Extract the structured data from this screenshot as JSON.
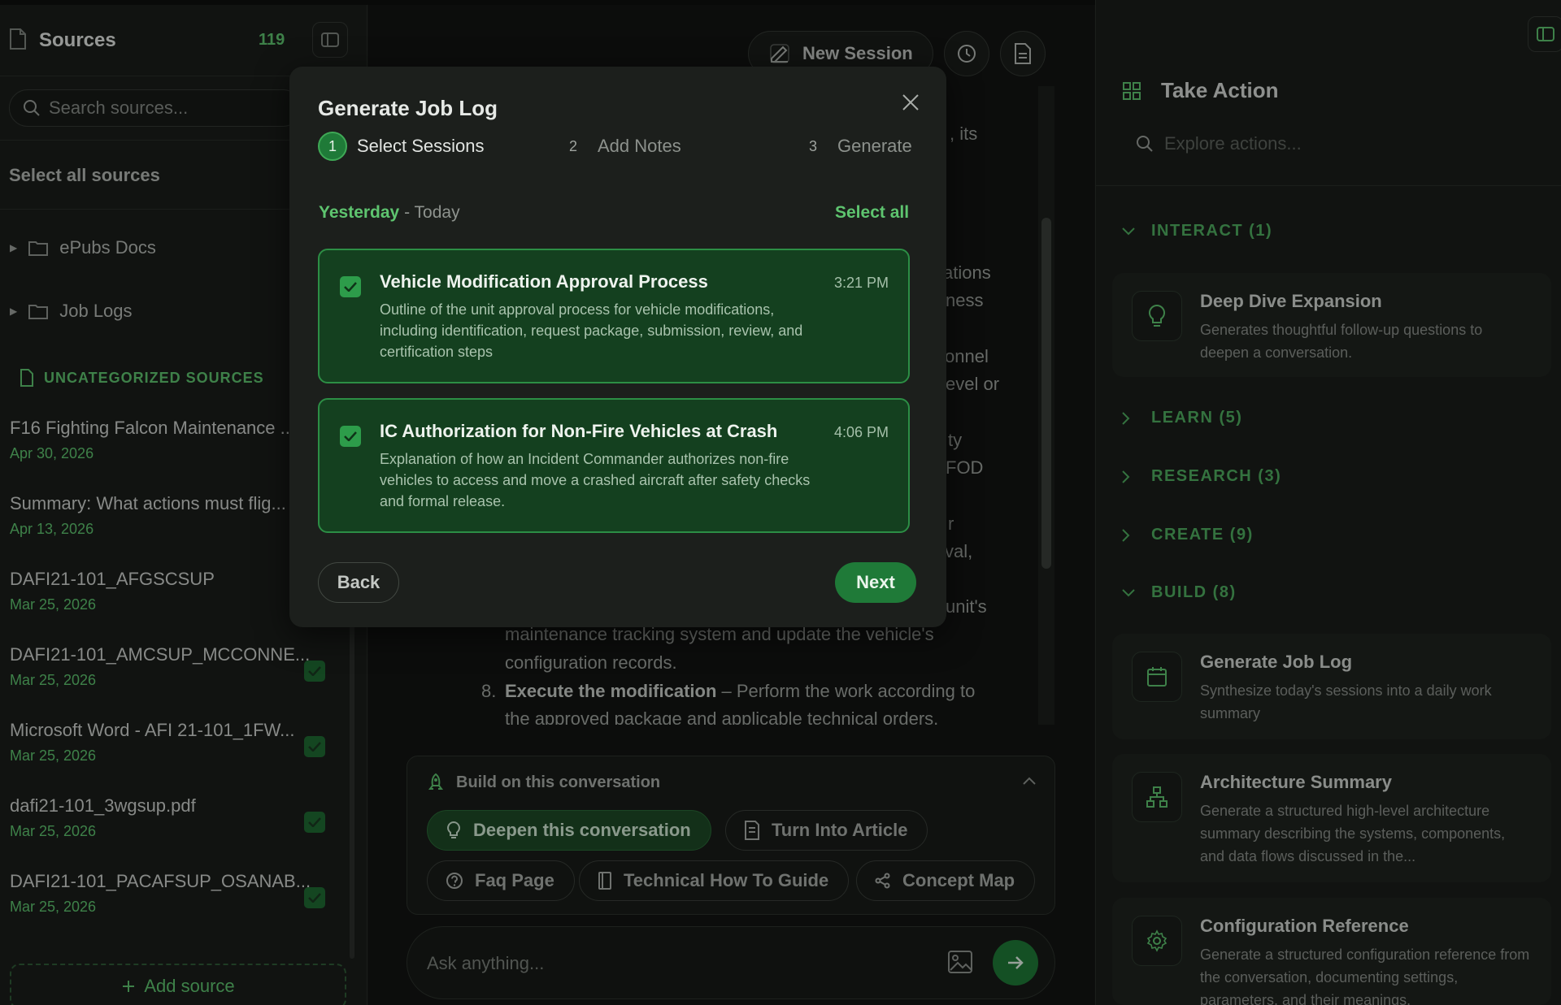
{
  "sidebar": {
    "title": "Sources",
    "count": "119",
    "search_placeholder": "Search sources...",
    "select_all": "Select all sources",
    "folders": [
      {
        "label": "ePubs Docs"
      },
      {
        "label": "Job Logs"
      }
    ],
    "uncategorized_label": "UNCATEGORIZED SOURCES",
    "items": [
      {
        "title": "F16 Fighting Falcon Maintenance ...",
        "date": "Apr 30, 2026",
        "checked": false
      },
      {
        "title": "Summary: What actions must flig...",
        "date": "Apr 13, 2026",
        "checked": false
      },
      {
        "title": "DAFI21-101_AFGSCSUP",
        "date": "Mar 25, 2026",
        "checked": false
      },
      {
        "title": "DAFI21-101_AMCSUP_MCCONNE...",
        "date": "Mar 25, 2026",
        "checked": true
      },
      {
        "title": "Microsoft Word - AFI 21-101_1FW...",
        "date": "Mar 25, 2026",
        "checked": true
      },
      {
        "title": "dafi21-101_3wgsup.pdf",
        "date": "Mar 25, 2026",
        "checked": true
      },
      {
        "title": "DAFI21-101_PACAFSUP_OSANAB...",
        "date": "Mar 25, 2026",
        "checked": true
      }
    ],
    "add_source": "Add source"
  },
  "header": {
    "new_session": "New Session"
  },
  "chat": {
    "fragments": [
      ", its",
      "ations",
      "ness",
      "onnel",
      "evel or",
      "ty",
      "FOD",
      "r",
      "val,",
      "unit's"
    ],
    "line1": "maintenance tracking system and update the vehicle's",
    "line2": "configuration records.",
    "item8_num": "8.",
    "item8_bold": "Execute the modification",
    "item8_text": " – Perform the work according to",
    "item8_line2": "the approved package and applicable technical orders."
  },
  "build": {
    "heading": "Build on this conversation",
    "pills": [
      {
        "label": "Deepen this conversation",
        "active": true
      },
      {
        "label": "Turn Into Article",
        "active": false
      },
      {
        "label": "Faq Page",
        "active": false
      },
      {
        "label": "Technical How To Guide",
        "active": false
      },
      {
        "label": "Concept Map",
        "active": false
      }
    ]
  },
  "ask": {
    "placeholder": "Ask anything..."
  },
  "right_panel": {
    "title": "Take Action",
    "search_placeholder": "Explore actions...",
    "sections": {
      "interact": "INTERACT (1)",
      "learn": "LEARN (5)",
      "research": "RESEARCH (3)",
      "create": "CREATE (9)",
      "build": "BUILD (8)"
    },
    "cards": [
      {
        "title": "Deep Dive Expansion",
        "desc": "Generates thoughtful follow-up questions to deepen a conversation."
      },
      {
        "title": "Generate Job Log",
        "desc": "Synthesize today's sessions into a daily work summary"
      },
      {
        "title": "Architecture Summary",
        "desc": "Generate a structured high-level architecture summary describing the systems, components, and data flows discussed in the..."
      },
      {
        "title": "Configuration Reference",
        "desc": "Generate a structured configuration reference from the conversation, documenting settings, parameters, and their meanings."
      }
    ]
  },
  "modal": {
    "title": "Generate Job Log",
    "steps": [
      {
        "num": "1",
        "label": "Select Sessions"
      },
      {
        "num": "2",
        "label": "Add Notes"
      },
      {
        "num": "3",
        "label": "Generate"
      }
    ],
    "range_from": "Yesterday",
    "range_to": " - Today",
    "select_all": "Select all",
    "sessions": [
      {
        "title": "Vehicle Modification Approval Process",
        "time": "3:21 PM",
        "desc": "Outline of the unit approval process for vehicle modifications, including identification, request package, submission, review, and certification steps",
        "checked": true
      },
      {
        "title": "IC Authorization for Non-Fire Vehicles at Crash",
        "time": "4:06 PM",
        "desc": "Explanation of how an Incident Commander authorizes non-fire vehicles to access and move a crashed aircraft after safety checks and formal release.",
        "checked": true
      }
    ],
    "back": "Back",
    "next": "Next"
  },
  "colors": {
    "accent": "#5ec46f",
    "primary_button": "#1f7a38",
    "selected_card_bg": "#14401f",
    "background": "#131513"
  }
}
